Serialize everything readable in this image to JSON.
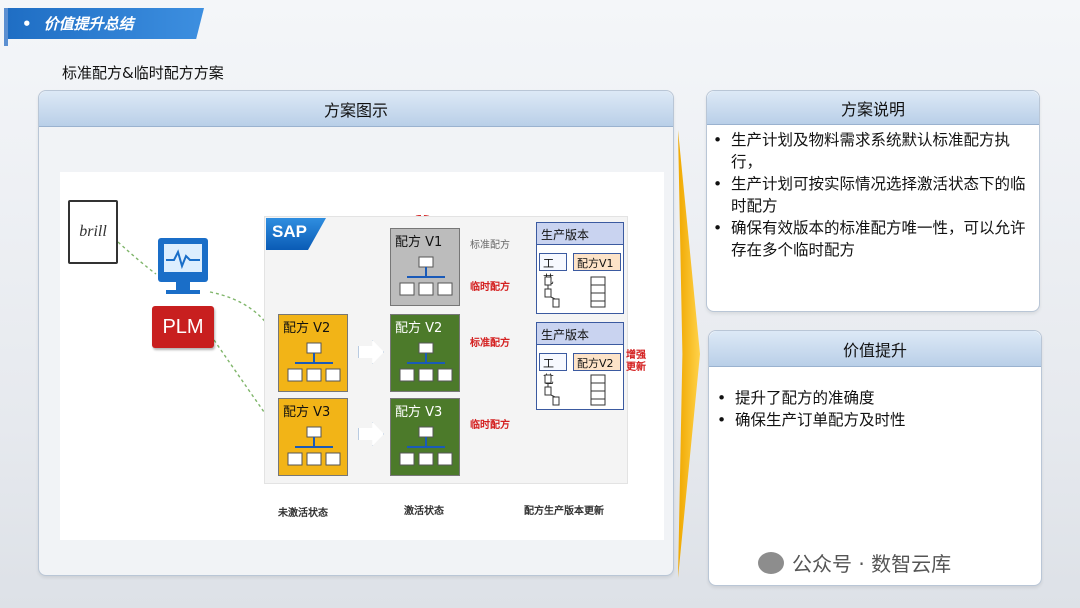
{
  "header": {
    "bullet": "•",
    "title": "价值提升总结"
  },
  "subtitle": "标准配方&临时配方方案",
  "main_panel": {
    "title": "方案图示"
  },
  "diagram": {
    "brill_logo": "brill",
    "plm_label": "PLM",
    "sap_logo": "SAP",
    "recipes": {
      "v1": "配方 V1",
      "v2_left": "配方 V2",
      "v3_left": "配方 V3",
      "v2_mid": "配方 V2",
      "v3_mid": "配方 V3"
    },
    "labels": {
      "standard_gray": "标准配方",
      "temp_1": "临时配方",
      "standard_red": "标准配方",
      "temp_2": "临时配方",
      "enhanced": "增强\n更新"
    },
    "prod_version": {
      "title_1": "生产版本",
      "title_2": "生产版本",
      "craft_1": "工艺",
      "craft_2": "工艺",
      "recipe_1": "配方V1",
      "recipe_2": "配方V2"
    },
    "states": {
      "inactive": "未激活状态",
      "active": "激活状态",
      "update": "配方生产版本更新"
    }
  },
  "scheme_panel": {
    "title": "方案说明",
    "items": [
      "生产计划及物料需求系统默认标准配方执行，",
      "生产计划可按实际情况选择激活状态下的临时配方",
      "确保有效版本的标准配方唯一性，可以允许存在多个临时配方"
    ]
  },
  "value_panel": {
    "title": "价值提升",
    "items": [
      "提升了配方的准确度",
      "确保生产订单配方及时性"
    ]
  },
  "watermark": "公众号 · 数智云库",
  "colors": {
    "header_blue": "#1f6ec4",
    "plm_red": "#c81f1f",
    "recipe_yellow": "#f2b417",
    "recipe_green": "#4c7a2a",
    "highlight_red": "#d42020",
    "chevron_orange": "#f0a800"
  }
}
